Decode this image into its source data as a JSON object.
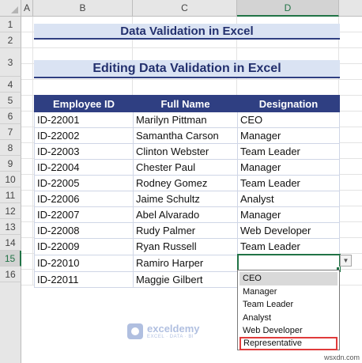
{
  "columns": [
    "A",
    "B",
    "C",
    "D"
  ],
  "rows": [
    "1",
    "2",
    "3",
    "4",
    "5",
    "6",
    "7",
    "8",
    "9",
    "10",
    "11",
    "12",
    "13",
    "14",
    "15",
    "16"
  ],
  "titles": {
    "main": "Data Validation in Excel",
    "sub": "Editing Data Validation in Excel"
  },
  "table": {
    "headers": [
      "Employee ID",
      "Full Name",
      "Designation"
    ],
    "rows": [
      {
        "id": "ID-22001",
        "name": "Marilyn Pittman",
        "designation": "CEO"
      },
      {
        "id": "ID-22002",
        "name": "Samantha Carson",
        "designation": "Manager"
      },
      {
        "id": "ID-22003",
        "name": "Clinton Webster",
        "designation": "Team Leader"
      },
      {
        "id": "ID-22004",
        "name": "Chester Paul",
        "designation": "Manager"
      },
      {
        "id": "ID-22005",
        "name": "Rodney Gomez",
        "designation": "Team Leader"
      },
      {
        "id": "ID-22006",
        "name": "Jaime Schultz",
        "designation": "Analyst"
      },
      {
        "id": "ID-22007",
        "name": "Abel Alvarado",
        "designation": "Manager"
      },
      {
        "id": "ID-22008",
        "name": "Rudy Palmer",
        "designation": "Web Developer"
      },
      {
        "id": "ID-22009",
        "name": "Ryan Russell",
        "designation": "Team Leader"
      },
      {
        "id": "ID-22010",
        "name": "Ramiro Harper",
        "designation": ""
      },
      {
        "id": "ID-22011",
        "name": "Maggie Gilbert",
        "designation": ""
      }
    ]
  },
  "dropdown": {
    "options": [
      "CEO",
      "Manager",
      "Team Leader",
      "Analyst",
      "Web Developer",
      "Representative"
    ],
    "selected": "CEO",
    "highlighted": "Representative",
    "button_icon": "chevron-down-icon"
  },
  "watermark": {
    "name": "exceldemy",
    "tagline": "EXCEL · DATA · BI"
  },
  "corner_watermark": "wsxdn.com",
  "colors": {
    "header_fill": "#2f3f82",
    "title_fill": "#dae3f3",
    "selection_green": "#217346",
    "highlight_red": "#e03b3b"
  }
}
